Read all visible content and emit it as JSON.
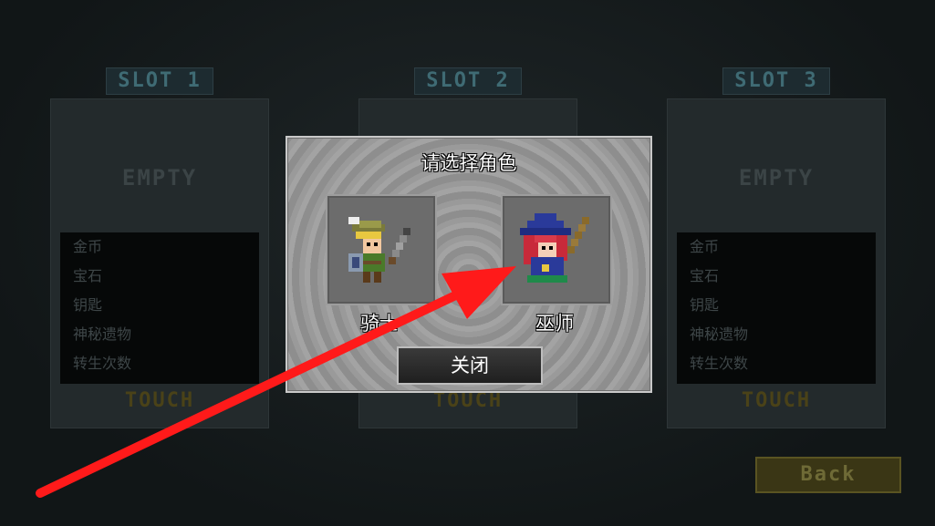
{
  "slots": [
    {
      "tab": "SLOT 1",
      "status": "EMPTY",
      "info": [
        "金币",
        "宝石",
        "钥匙",
        "神秘遗物",
        "转生次数"
      ],
      "touch": "TOUCH"
    },
    {
      "tab": "SLOT 2",
      "status": "",
      "info": [],
      "touch": "TOUCH"
    },
    {
      "tab": "SLOT 3",
      "status": "EMPTY",
      "info": [
        "金币",
        "宝石",
        "钥匙",
        "神秘遗物",
        "转生次数"
      ],
      "touch": "TOUCH"
    }
  ],
  "back_label": "Back",
  "dialog": {
    "title": "请选择角色",
    "characters": [
      {
        "label": "骑士",
        "icon": "knight-sprite-icon"
      },
      {
        "label": "巫师",
        "icon": "wizard-sprite-icon"
      }
    ],
    "close_label": "关闭"
  },
  "annotation": {
    "type": "arrow",
    "color": "#ff1a1a"
  }
}
